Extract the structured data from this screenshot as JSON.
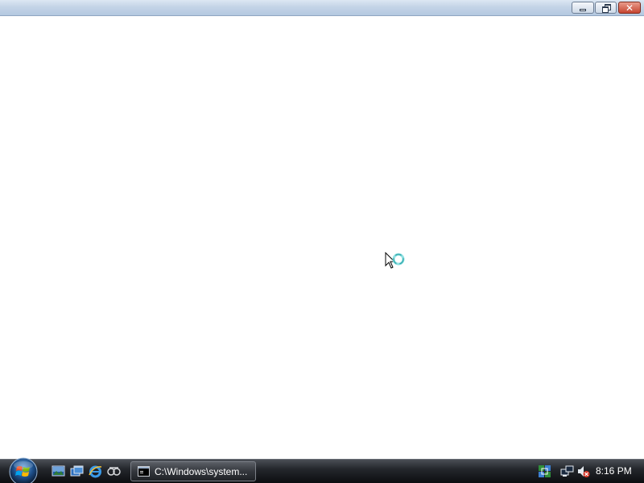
{
  "window": {
    "title_bar": {
      "minimize_icon": "minimize-icon",
      "maximize_icon": "restore-icon",
      "close_icon": "close-icon",
      "close_glyph": "✕"
    }
  },
  "content": {
    "cursor_icon": "busy-pointer-icon"
  },
  "taskbar": {
    "start_button_icon": "windows-start-orb-icon",
    "quick_launch": [
      "show-desktop-icon",
      "switch-windows-icon",
      "internet-explorer-icon",
      "media-icon"
    ],
    "task_button": {
      "label": "C:\\Windows\\system...",
      "icon": "command-prompt-icon"
    },
    "tray": {
      "icons": [
        "network-status-icon",
        "network-icon",
        "volume-muted-icon"
      ],
      "clock": "8:16 PM"
    }
  },
  "colors": {
    "title_bar": "#c4d4e7",
    "close_button": "#c64531",
    "taskbar": "#1f2226",
    "background": "#ffffff"
  }
}
